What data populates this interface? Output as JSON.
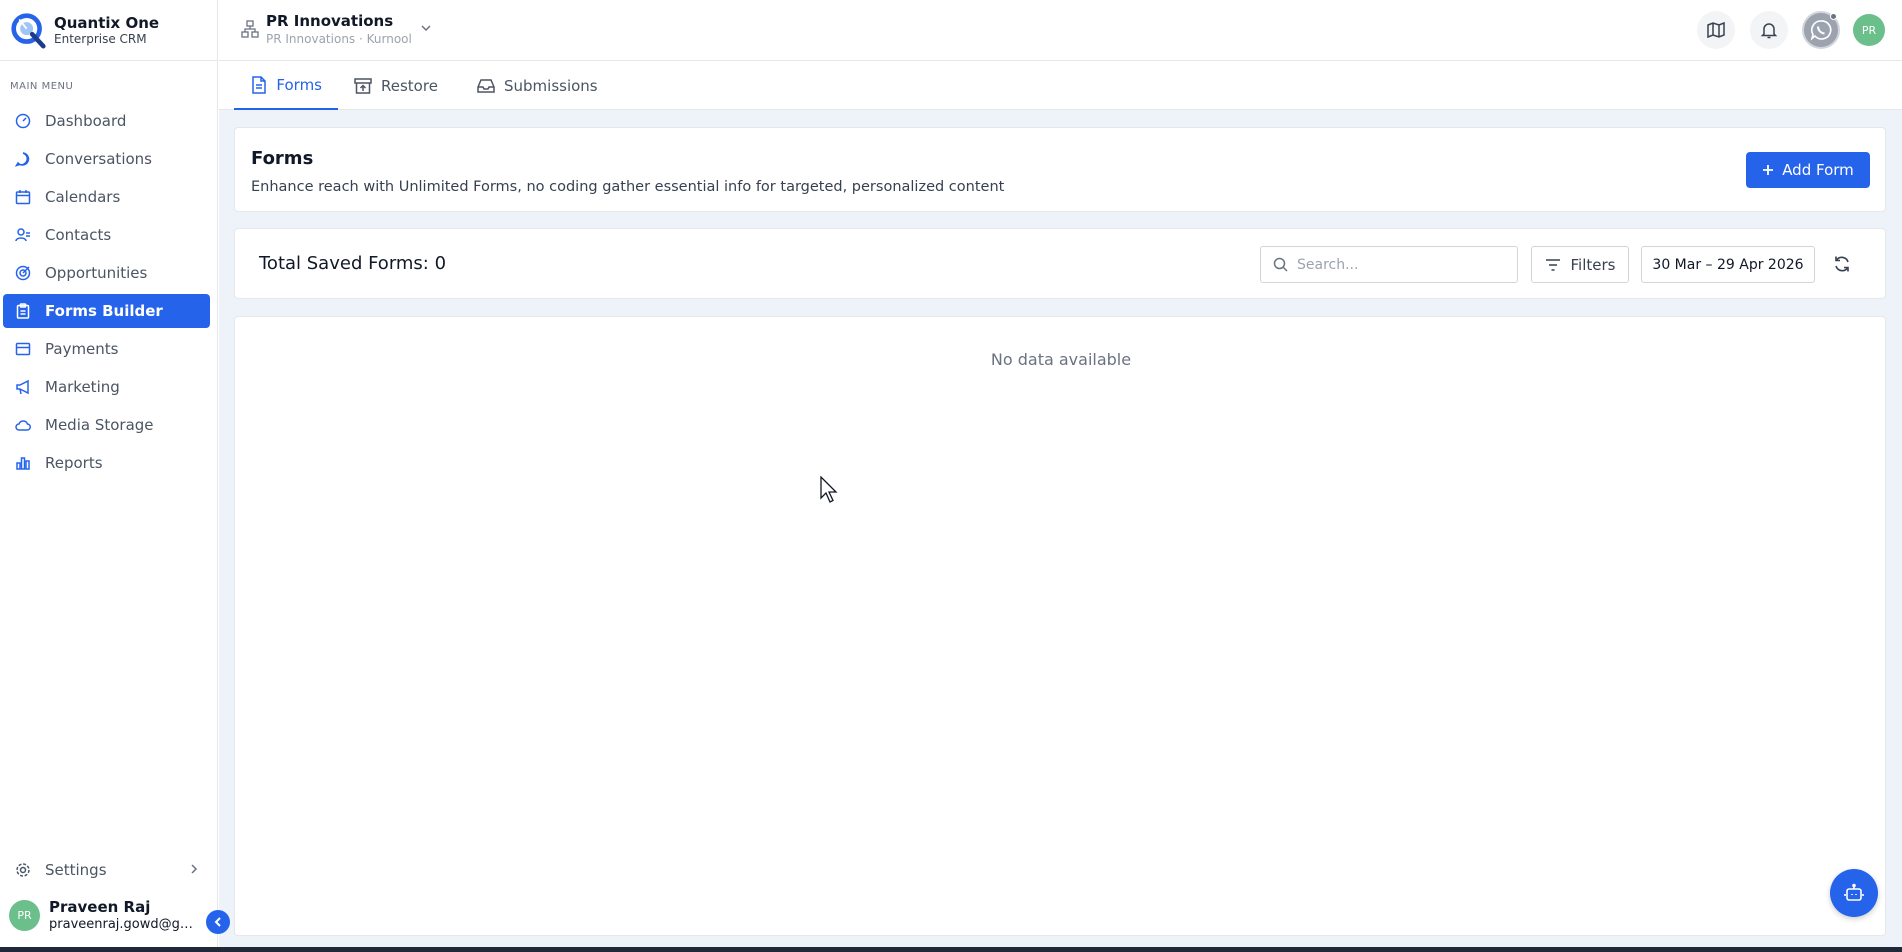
{
  "brand": {
    "title": "Quantix One",
    "subtitle": "Enterprise CRM"
  },
  "sidebar": {
    "heading": "MAIN MENU",
    "items": [
      {
        "label": "Dashboard",
        "icon": "gauge-icon"
      },
      {
        "label": "Conversations",
        "icon": "chat-icon"
      },
      {
        "label": "Calendars",
        "icon": "calendar-icon"
      },
      {
        "label": "Contacts",
        "icon": "contacts-icon"
      },
      {
        "label": "Opportunities",
        "icon": "target-icon"
      },
      {
        "label": "Forms Builder",
        "icon": "clipboard-icon",
        "active": true
      },
      {
        "label": "Payments",
        "icon": "card-icon"
      },
      {
        "label": "Marketing",
        "icon": "megaphone-icon"
      },
      {
        "label": "Media Storage",
        "icon": "cloud-icon"
      },
      {
        "label": "Reports",
        "icon": "bar-chart-icon"
      }
    ],
    "settings_label": "Settings",
    "user": {
      "initials": "PR",
      "name": "Praveen Raj",
      "email": "praveenraj.gowd@gmail.com"
    }
  },
  "topbar": {
    "org_name": "PR Innovations",
    "org_sub": "PR Innovations · Kurnool",
    "avatar_initials": "PR"
  },
  "tabs": [
    {
      "label": "Forms",
      "active": true
    },
    {
      "label": "Restore"
    },
    {
      "label": "Submissions"
    }
  ],
  "header": {
    "title": "Forms",
    "description": "Enhance reach with Unlimited Forms, no coding gather essential info for targeted, personalized content",
    "add_label": "Add Form"
  },
  "toolbar": {
    "total_label": "Total Saved Forms: 0",
    "search_placeholder": "Search...",
    "filters_label": "Filters",
    "date_range": "30 Mar – 29 Apr 2026"
  },
  "table": {
    "empty_text": "No data available"
  },
  "colors": {
    "accent": "#2563eb",
    "avatar": "#6bbf8a",
    "background": "#eef2f9"
  }
}
